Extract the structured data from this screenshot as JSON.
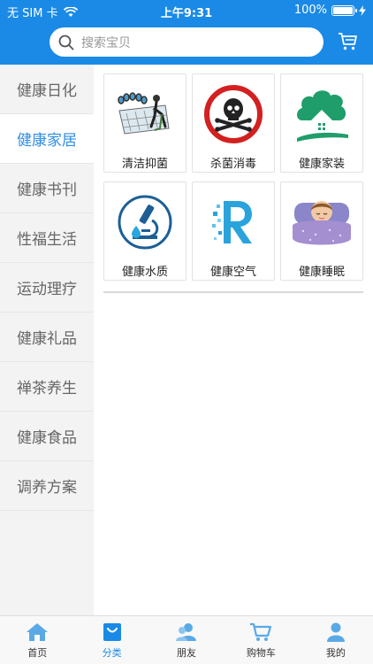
{
  "status_bar": {
    "carrier": "无 SIM 卡",
    "time": "上午9:31",
    "battery": "100%"
  },
  "search": {
    "placeholder": "搜索宝贝"
  },
  "sidebar": {
    "items": [
      {
        "label": "健康日化",
        "active": false
      },
      {
        "label": "健康家居",
        "active": true
      },
      {
        "label": "健康书刊",
        "active": false
      },
      {
        "label": "性福生活",
        "active": false
      },
      {
        "label": "运动理疗",
        "active": false
      },
      {
        "label": "健康礼品",
        "active": false
      },
      {
        "label": "禅茶养生",
        "active": false
      },
      {
        "label": "健康食品",
        "active": false
      },
      {
        "label": "调养方案",
        "active": false
      }
    ]
  },
  "products": [
    {
      "label": "清洁抑菌",
      "icon": "cleaning-icon"
    },
    {
      "label": "杀菌消毒",
      "icon": "skull-warning-icon"
    },
    {
      "label": "健康家装",
      "icon": "green-house-icon"
    },
    {
      "label": "健康水质",
      "icon": "microscope-icon"
    },
    {
      "label": "健康空气",
      "icon": "air-r-icon"
    },
    {
      "label": "健康睡眠",
      "icon": "sleeping-person-icon"
    }
  ],
  "tabbar": {
    "tabs": [
      {
        "label": "首页",
        "icon": "home-icon"
      },
      {
        "label": "分类",
        "icon": "bag-icon",
        "active": true
      },
      {
        "label": "朋友",
        "icon": "friends-icon"
      },
      {
        "label": "购物车",
        "icon": "cart-icon"
      },
      {
        "label": "我的",
        "icon": "user-icon"
      }
    ]
  },
  "colors": {
    "brand": "#1a8ae6",
    "active_text": "#2f8de4",
    "sidebar_bg": "#f3f3f3"
  }
}
